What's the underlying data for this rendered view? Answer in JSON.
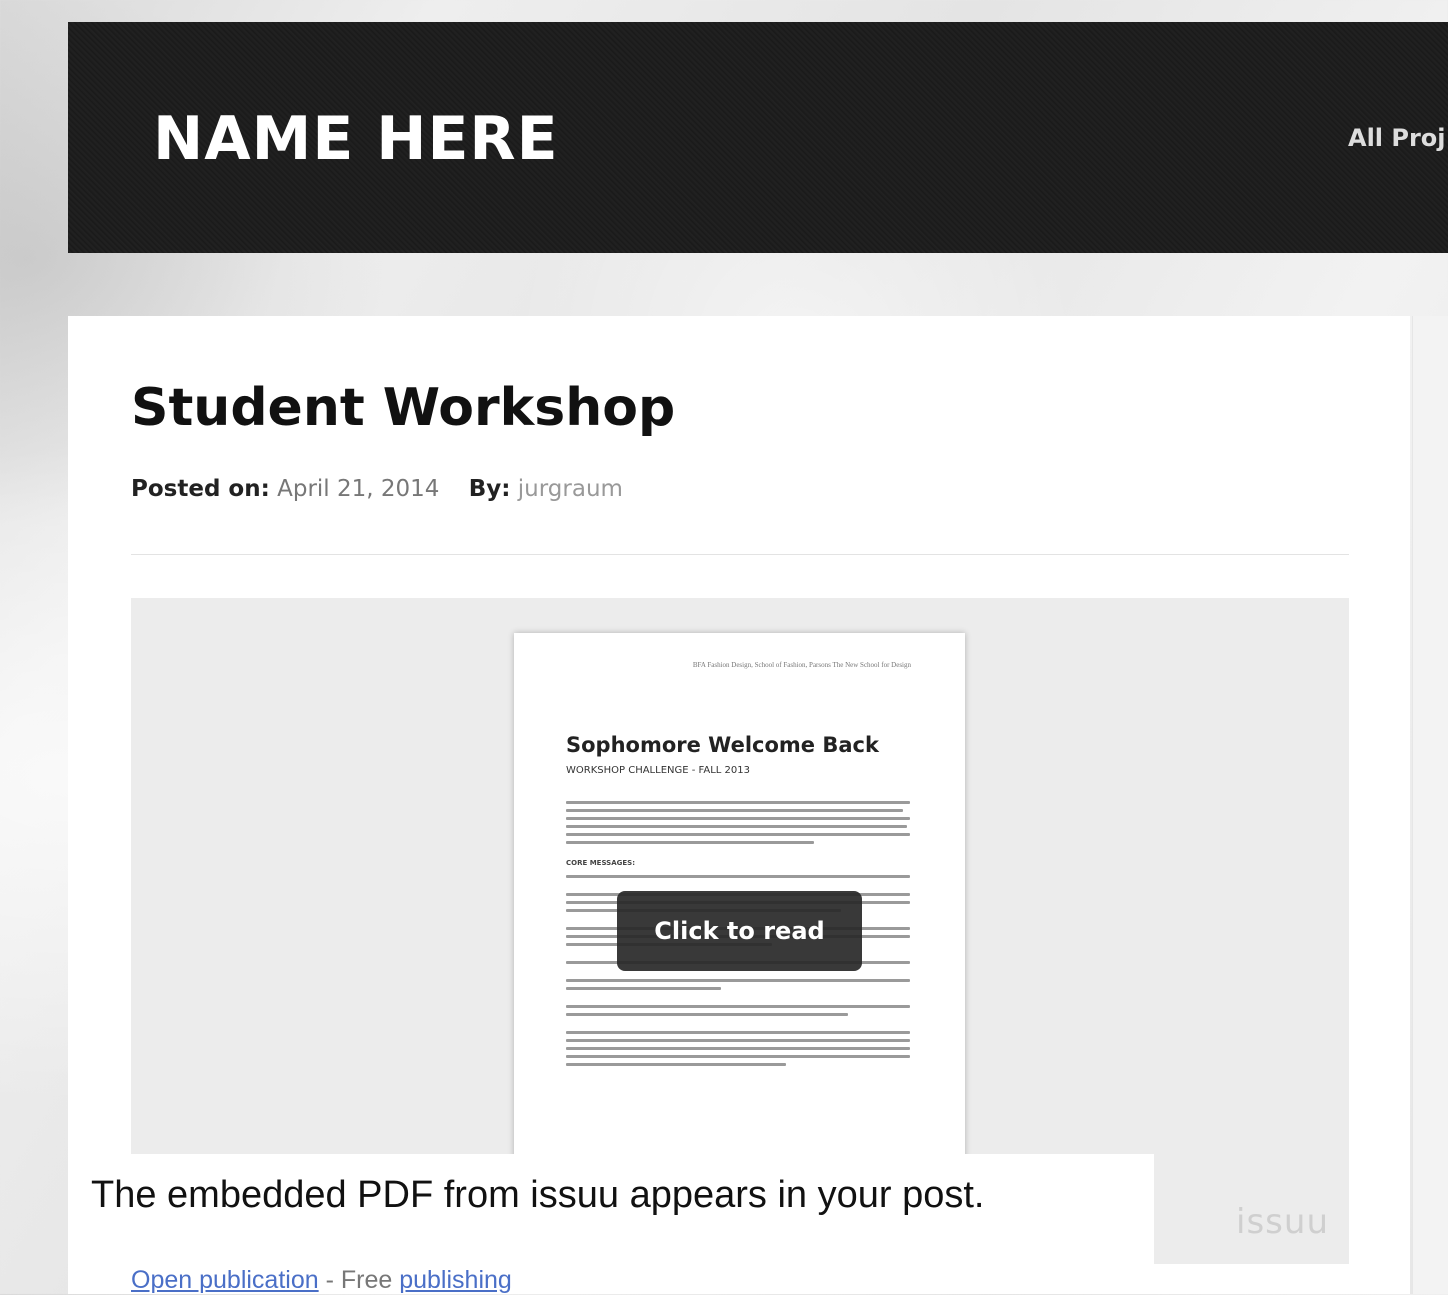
{
  "site": {
    "title": "NAME HERE",
    "nav": [
      {
        "label": "All Proj"
      }
    ]
  },
  "post": {
    "title": "Student Workshop",
    "posted_on_label": "Posted on:",
    "posted_on_value": "April 21, 2014",
    "by_label": "By:",
    "author": "jurgraum"
  },
  "embed": {
    "document": {
      "header_line": "BFA Fashion Design, School of Fashion, Parsons The New School for Design",
      "title": "Sophomore Welcome Back",
      "subtitle": "WORKSHOP CHALLENGE - FALL 2013",
      "section_heading": "CORE MESSAGES:"
    },
    "overlay_button": "Click to read",
    "brand": "issuu",
    "caption": "The embedded PDF from issuu appears in your post.",
    "footer": {
      "open_link": "Open publication",
      "separator": " - Free ",
      "publishing_link": "publishing"
    }
  }
}
